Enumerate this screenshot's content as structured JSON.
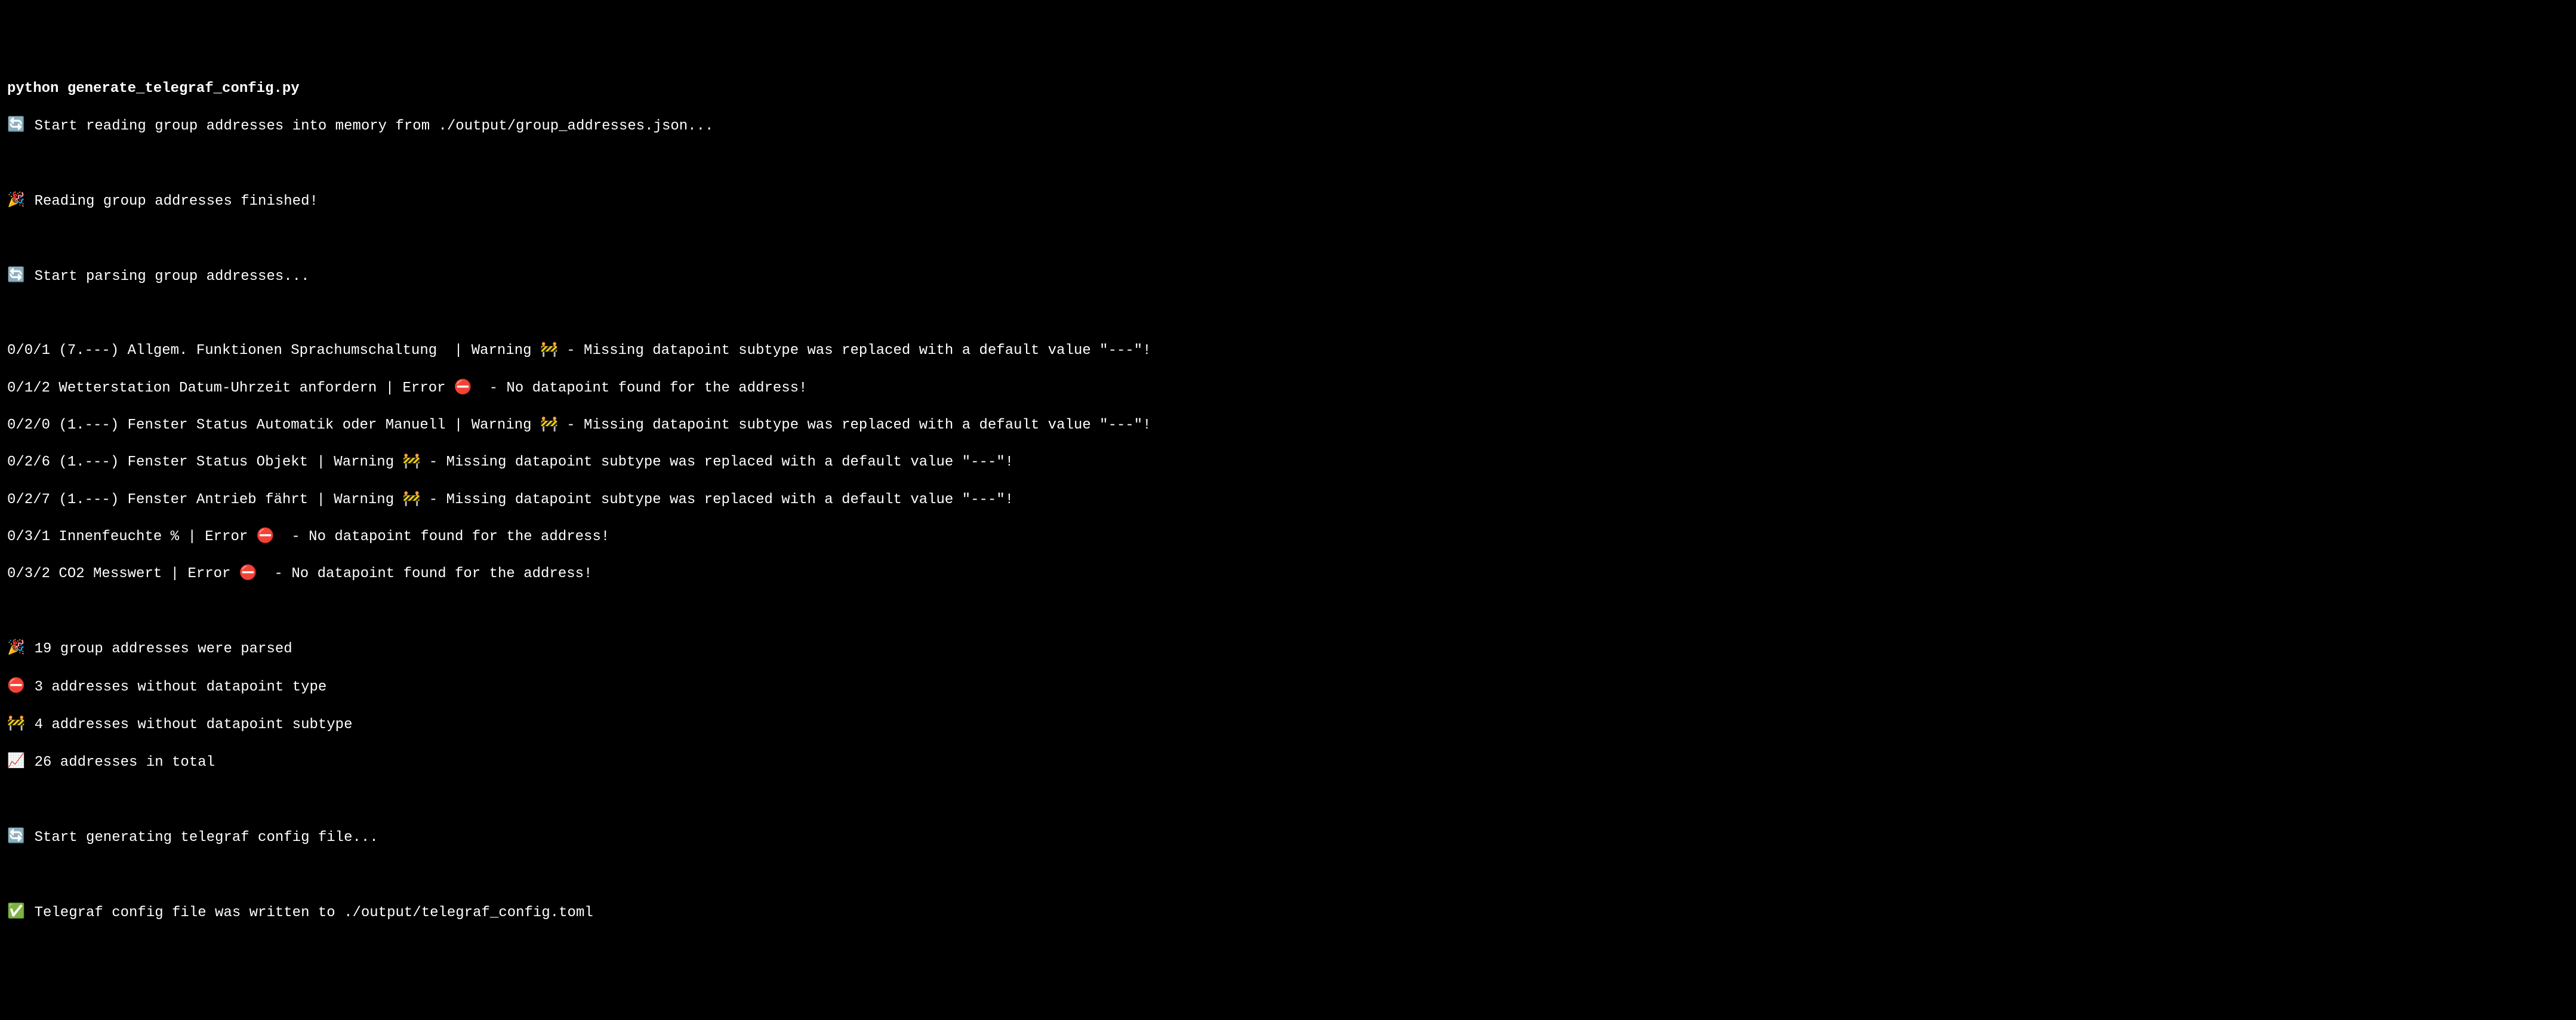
{
  "command": "python generate_telegraf_config.py",
  "emojis": {
    "refresh": "🔄",
    "party": "🎉",
    "construction": "🚧",
    "no_entry": "⛔",
    "chart": "📈",
    "check": "✅"
  },
  "msg_start_reading": " Start reading group addresses into memory from ./output/group_addresses.json...",
  "msg_reading_finished": " Reading group addresses finished!",
  "msg_start_parsing": " Start parsing group addresses...",
  "log_lines": [
    "0/0/1 (7.---) Allgem. Funktionen Sprachumschaltung  | Warning 🚧 - Missing datapoint subtype was replaced with a default value \"---\"!",
    "0/1/2 Wetterstation Datum-Uhrzeit anfordern | Error ⛔  - No datapoint found for the address!",
    "0/2/0 (1.---) Fenster Status Automatik oder Manuell | Warning 🚧 - Missing datapoint subtype was replaced with a default value \"---\"!",
    "0/2/6 (1.---) Fenster Status Objekt | Warning 🚧 - Missing datapoint subtype was replaced with a default value \"---\"!",
    "0/2/7 (1.---) Fenster Antrieb fährt | Warning 🚧 - Missing datapoint subtype was replaced with a default value \"---\"!",
    "0/3/1 Innenfeuchte % | Error ⛔  - No datapoint found for the address!",
    "0/3/2 CO2 Messwert | Error ⛔  - No datapoint found for the address!"
  ],
  "summary_parsed": " 19 group addresses were parsed",
  "summary_no_type": " 3 addresses without datapoint type",
  "summary_no_subtype": " 4 addresses without datapoint subtype",
  "summary_total": " 26 addresses in total",
  "msg_start_generating": " Start generating telegraf config file...",
  "msg_written": " Telegraf config file was written to ./output/telegraf_config.toml"
}
